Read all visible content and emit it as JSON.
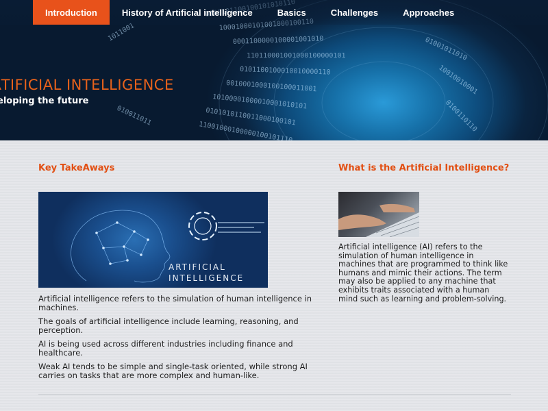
{
  "nav": {
    "items": [
      {
        "label": "Introduction",
        "active": true
      },
      {
        "label": "History of Artificial intelligence"
      },
      {
        "label": "Basics"
      },
      {
        "label": "Challenges"
      },
      {
        "label": "Approaches"
      }
    ]
  },
  "hero": {
    "title": "RTIFICIAL INTELLIGENCE",
    "subtitle": "eloping the future"
  },
  "left": {
    "section_title": "Key TakeAways",
    "image_label_line1": "ARTIFICIAL",
    "image_label_line2": "INTELLIGENCE",
    "paragraphs": [
      "Artificial intelligence refers to the simulation of human intelligence in machines.",
      "The goals of artificial intelligence include learning, reasoning, and perception.",
      "AI is being used across different industries including finance and healthcare.",
      "Weak AI tends to be simple and single-task oriented, while strong AI carries on tasks that are more complex and human-like."
    ]
  },
  "right": {
    "section_title": "What is the Artificial Intelligence?",
    "body": "Artificial intelligence (AI) refers to the simulation of human intelligence in machines that are programmed to think like humans and mimic their actions. The term may also be applied to any machine that exhibits traits associated with a human mind such as learning and problem-solving."
  },
  "colors": {
    "accent": "#e8521b",
    "hero_dark": "#0a2440",
    "hero_light": "#2a9ad8"
  }
}
